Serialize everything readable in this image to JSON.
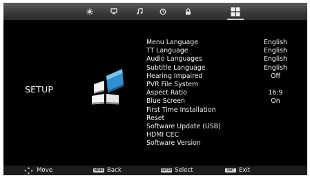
{
  "tabs": [
    {
      "icon": "picture-icon"
    },
    {
      "icon": "monitor-icon"
    },
    {
      "icon": "music-note-icon"
    },
    {
      "icon": "clock-icon"
    },
    {
      "icon": "lock-icon"
    },
    {
      "icon": "setup-grid-icon",
      "active": true
    }
  ],
  "page_title": "SETUP",
  "menu": [
    {
      "label": "Menu Language",
      "value": "English"
    },
    {
      "label": "TT Language",
      "value": "English"
    },
    {
      "label": "Audio Languages",
      "value": "English"
    },
    {
      "label": "Subtitle Language",
      "value": "English"
    },
    {
      "label": "Hearing Impaired",
      "value": "Off"
    },
    {
      "label": "PVR File System",
      "value": ""
    },
    {
      "label": "Aspect Ratio",
      "value": "16:9"
    },
    {
      "label": "Blue Screen",
      "value": "On"
    },
    {
      "label": "First Time Installation",
      "value": ""
    },
    {
      "label": "Reset",
      "value": ""
    },
    {
      "label": "Software Update (USB)",
      "value": ""
    },
    {
      "label": "HDMI CEC",
      "value": ""
    },
    {
      "label": "Software Version",
      "value": ""
    }
  ],
  "hints": {
    "move": "Move",
    "menu_key": "MENU",
    "back": "Back",
    "enter_key": "ENTER",
    "select": "Select",
    "exit_key": "EXIT",
    "exit": "Exit"
  },
  "colors": {
    "background": "#000000",
    "topbar": "#4a4a4a",
    "text": "#f2f2f2",
    "logo_blue": "#3aa0dc"
  }
}
